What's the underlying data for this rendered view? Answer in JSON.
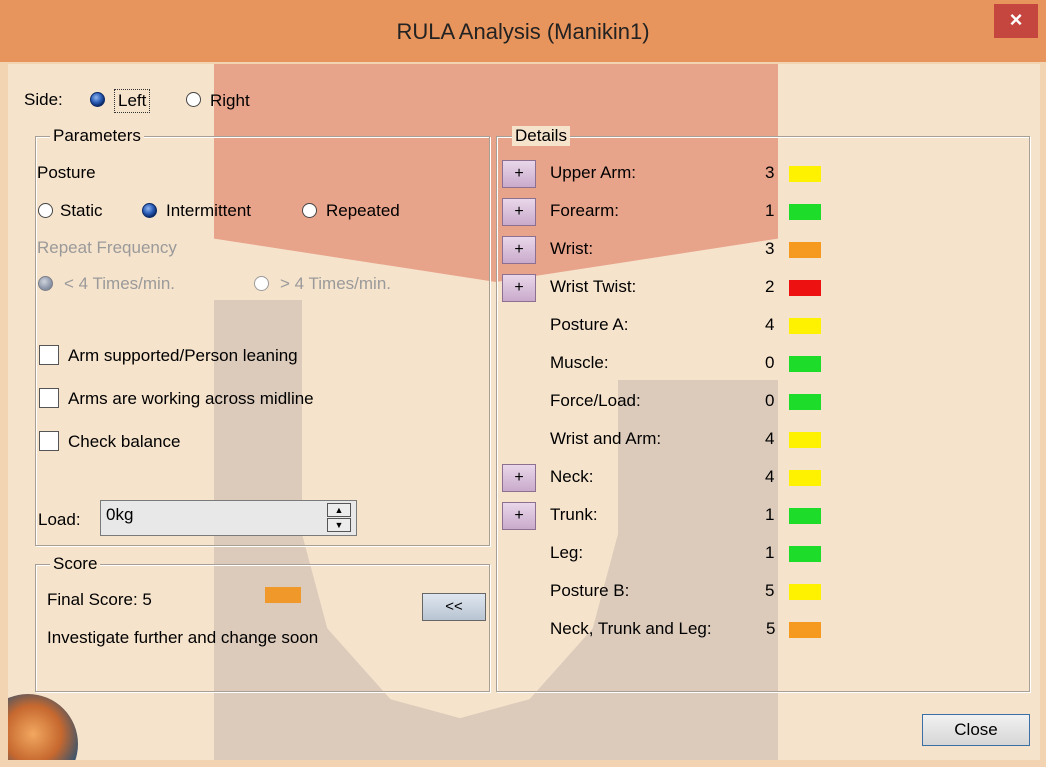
{
  "window": {
    "title": "RULA Analysis (Manikin1)",
    "close_glyph": "×"
  },
  "side": {
    "label": "Side:",
    "options": [
      "Left",
      "Right"
    ],
    "selected": "Left"
  },
  "parameters": {
    "legend": "Parameters",
    "posture_label": "Posture",
    "posture_options": [
      "Static",
      "Intermittent",
      "Repeated"
    ],
    "posture_selected": "Intermittent",
    "repeat_frequency_label": "Repeat Frequency",
    "repeat_options": [
      "< 4 Times/min.",
      "> 4 Times/min."
    ],
    "repeat_selected": "< 4 Times/min.",
    "checkboxes": [
      "Arm supported/Person leaning",
      "Arms are working across midline",
      "Check balance"
    ],
    "load_label": "Load:",
    "load_value": "0kg"
  },
  "score": {
    "legend": "Score",
    "final_score_text": "Final Score: 5",
    "final_score_color": "#f0982a",
    "message": "Investigate further and change soon",
    "collapse_button": "<<"
  },
  "details": {
    "legend": "Details",
    "expand_glyph": "+",
    "rows": [
      {
        "label": "Upper Arm:",
        "value": "3",
        "color": "#fff200",
        "expandable": true
      },
      {
        "label": "Forearm:",
        "value": "1",
        "color": "#1ddc2a",
        "expandable": true
      },
      {
        "label": "Wrist:",
        "value": "3",
        "color": "#f59a1e",
        "expandable": true
      },
      {
        "label": "Wrist Twist:",
        "value": "2",
        "color": "#ee1111",
        "expandable": true
      },
      {
        "label": "Posture A:",
        "value": "4",
        "color": "#fff200",
        "expandable": false
      },
      {
        "label": "Muscle:",
        "value": "0",
        "color": "#1ddc2a",
        "expandable": false
      },
      {
        "label": "Force/Load:",
        "value": "0",
        "color": "#1ddc2a",
        "expandable": false
      },
      {
        "label": "Wrist and Arm:",
        "value": "4",
        "color": "#fff200",
        "expandable": false
      },
      {
        "label": "Neck:",
        "value": "4",
        "color": "#fff200",
        "expandable": true
      },
      {
        "label": "Trunk:",
        "value": "1",
        "color": "#1ddc2a",
        "expandable": true
      },
      {
        "label": "Leg:",
        "value": "1",
        "color": "#1ddc2a",
        "expandable": false
      },
      {
        "label": "Posture B:",
        "value": "5",
        "color": "#fff200",
        "expandable": false
      },
      {
        "label": "Neck, Trunk and Leg:",
        "value": "5",
        "color": "#f59a1e",
        "expandable": false
      }
    ]
  },
  "footer": {
    "close_button": "Close"
  }
}
